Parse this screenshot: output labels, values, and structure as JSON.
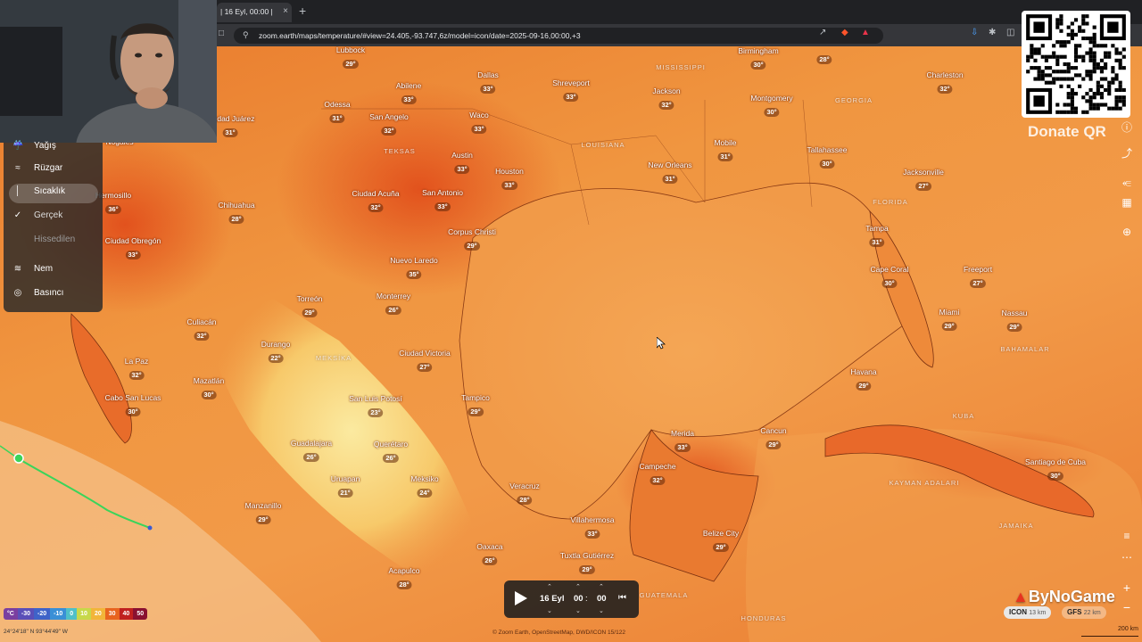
{
  "browser": {
    "tab_title": "| 16 Eyl, 00:00 | 2",
    "tab_close": "×",
    "new_tab": "+",
    "url": "zoom.earth/maps/temperature/#view=24.405,-93.747,6z/model=icon/date=2025-09-16,00:00,+3"
  },
  "layer_menu": {
    "items": [
      {
        "label": "Yağış",
        "icon": "rain-icon"
      },
      {
        "label": "Rüzgar",
        "icon": "wind-icon"
      },
      {
        "label": "Sıcaklık",
        "icon": "thermometer-icon",
        "active": true
      },
      {
        "label": "Gerçek",
        "icon": "check-icon",
        "sub": true
      },
      {
        "label": "Hissedilen",
        "icon": "",
        "sub": true,
        "dim": true
      },
      {
        "label": "Nem",
        "icon": "humidity-icon"
      },
      {
        "label": "Basıncı",
        "icon": "pressure-icon"
      }
    ]
  },
  "donate": "Donate QR",
  "legend": {
    "unit": "°C",
    "stops": [
      "-30",
      "-20",
      "-10",
      "0",
      "10",
      "20",
      "30",
      "40",
      "50"
    ],
    "colors": [
      "#7a3fa0",
      "#5a4fb8",
      "#3f63c8",
      "#3a8fd6",
      "#4fc0c8",
      "#c8d84a",
      "#f2b53a",
      "#e8641f",
      "#c0201f",
      "#8a1030"
    ]
  },
  "coords": "24°24'18\" N  93°44'49\" W",
  "attribution": "© Zoom Earth, OpenStreetMap, DWD/ICON 15/122",
  "scale_label": "200 km",
  "player": {
    "date": "16 Eyl",
    "hour": "00",
    "minute": "00"
  },
  "brand": "ByNoGame",
  "models": [
    {
      "name": "ICON",
      "res": "13 km"
    },
    {
      "name": "GFS",
      "res": "22 km"
    }
  ],
  "countries": [
    {
      "label": "MISSISSIPPI"
    },
    {
      "label": "GEORGIA"
    },
    {
      "label": "LOUISIANA"
    },
    {
      "label": "TEKSAS"
    },
    {
      "label": "FLORIDA"
    },
    {
      "label": "MEKSİKA"
    },
    {
      "label": "KUBA"
    },
    {
      "label": "BAHAMALAR"
    },
    {
      "label": "KAYMAN ADALARI"
    },
    {
      "label": "JAMAIKA"
    },
    {
      "label": "GUATEMALA"
    },
    {
      "label": "HONDURAS"
    }
  ],
  "cities": [
    {
      "name": "Lubbock",
      "temp": "29°"
    },
    {
      "name": "Birmingham",
      "temp": "30°"
    },
    {
      "name": "",
      "temp": "28°"
    },
    {
      "name": "Abilene",
      "temp": "33°"
    },
    {
      "name": "Dallas",
      "temp": "33°"
    },
    {
      "name": "Shreveport",
      "temp": "33°"
    },
    {
      "name": "Jackson",
      "temp": "32°"
    },
    {
      "name": "Montgomery",
      "temp": "30°"
    },
    {
      "name": "Charleston",
      "temp": "32°"
    },
    {
      "name": "Odessa",
      "temp": "31°"
    },
    {
      "name": "San Angelo",
      "temp": "32°"
    },
    {
      "name": "Waco",
      "temp": "33°"
    },
    {
      "name": "Ciudad Juárez",
      "temp": "31°"
    },
    {
      "name": "Austin",
      "temp": "33°"
    },
    {
      "name": "Houston",
      "temp": "33°"
    },
    {
      "name": "Mobile",
      "temp": "31°"
    },
    {
      "name": "Tallahassee",
      "temp": "30°"
    },
    {
      "name": "New Orleans",
      "temp": "31°"
    },
    {
      "name": "Jacksonville",
      "temp": "27°"
    },
    {
      "name": "Nogales",
      "temp": ""
    },
    {
      "name": "Hermosillo",
      "temp": "36°"
    },
    {
      "name": "San Antonio",
      "temp": "33°"
    },
    {
      "name": "Ciudad Acuña",
      "temp": "32°"
    },
    {
      "name": "Chihuahua",
      "temp": "28°"
    },
    {
      "name": "Corpus Christi",
      "temp": "29°"
    },
    {
      "name": "Tampa",
      "temp": "31°"
    },
    {
      "name": "Ciudad Obregón",
      "temp": "33°"
    },
    {
      "name": "Nuevo Laredo",
      "temp": "35°"
    },
    {
      "name": "Cape Coral",
      "temp": "30°"
    },
    {
      "name": "Freeport",
      "temp": "27°"
    },
    {
      "name": "Miami",
      "temp": "29°"
    },
    {
      "name": "Torreón",
      "temp": "29°"
    },
    {
      "name": "Monterrey",
      "temp": "26°"
    },
    {
      "name": "Nassau",
      "temp": "29°"
    },
    {
      "name": "Culiacán",
      "temp": "32°"
    },
    {
      "name": "Durango",
      "temp": "22°"
    },
    {
      "name": "Ciudad Victoria",
      "temp": "27°"
    },
    {
      "name": "La Paz",
      "temp": "32°"
    },
    {
      "name": "Havana",
      "temp": "29°"
    },
    {
      "name": "Mazatlán",
      "temp": "30°"
    },
    {
      "name": "Cabo San Lucas",
      "temp": "30°"
    },
    {
      "name": "San Luis Potosí",
      "temp": "23°"
    },
    {
      "name": "Tampico",
      "temp": "29°"
    },
    {
      "name": "Cancun",
      "temp": "29°"
    },
    {
      "name": "Merida",
      "temp": "33°"
    },
    {
      "name": "Guadalajara",
      "temp": "26°"
    },
    {
      "name": "Querétaro",
      "temp": "26°"
    },
    {
      "name": "Santiago de Cuba",
      "temp": "30°"
    },
    {
      "name": "Campeche",
      "temp": "32°"
    },
    {
      "name": "Uruapan",
      "temp": "21°"
    },
    {
      "name": "Meksiko",
      "temp": "24°"
    },
    {
      "name": "Veracruz",
      "temp": "28°"
    },
    {
      "name": "Manzanillo",
      "temp": "29°"
    },
    {
      "name": "Villahermosa",
      "temp": "33°"
    },
    {
      "name": "Belize City",
      "temp": "29°"
    },
    {
      "name": "Oaxaca",
      "temp": "26°"
    },
    {
      "name": "Tuxtla Gutiérrez",
      "temp": "29°"
    },
    {
      "name": "Acapulco",
      "temp": "28°"
    }
  ]
}
